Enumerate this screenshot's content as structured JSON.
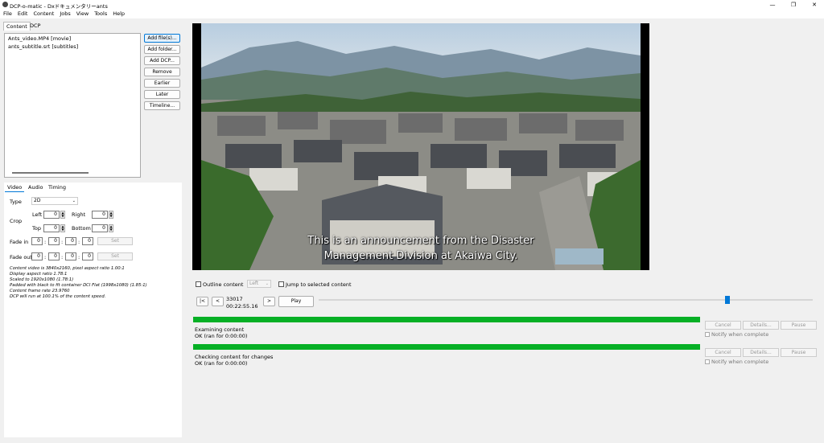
{
  "window": {
    "title": "DCP-o-matic - Dxドキュメンタリーants",
    "minimize": "—",
    "maximize": "❐",
    "close": "✕"
  },
  "menu": [
    "File",
    "Edit",
    "Content",
    "Jobs",
    "View",
    "Tools",
    "Help"
  ],
  "notebook_tabs": {
    "content": "Content",
    "dcp": "DCP"
  },
  "content_list": [
    "Ants_video.MP4 [movie]",
    "ants_subtitle.srt [subtitles]"
  ],
  "side_buttons": [
    "Add file(s)...",
    "Add folder...",
    "Add DCP...",
    "Remove",
    "Earlier",
    "Later",
    "Timeline..."
  ],
  "panel_tabs": {
    "video": "Video",
    "audio": "Audio",
    "timing": "Timing"
  },
  "video": {
    "type_label": "Type",
    "type_value": "2D",
    "crop_label": "Crop",
    "left_label": "Left",
    "left_value": "0",
    "right_label": "Right",
    "right_value": "0",
    "top_label": "Top",
    "top_value": "0",
    "bottom_label": "Bottom",
    "bottom_value": "0",
    "fade_in_label": "Fade in",
    "fade_out_label": "Fade out",
    "fade_in": [
      "0",
      "0",
      "0",
      "0"
    ],
    "fade_out": [
      "0",
      "0",
      "0",
      "0"
    ],
    "set_label": "Set",
    "info": [
      "Content video is 3840x2160, pixel aspect ratio 1.00:1",
      "Display aspect ratio 1.78:1",
      "Scaled to 1920x1080 (1.78:1)",
      "Padded with black to fit container DCI Flat (1998x1080) (1.85:1)",
      "Content frame rate 23.9760",
      "DCP will run at 100.1% of the content speed."
    ]
  },
  "viewer": {
    "subtitle_line1": "This is an announcement from the Disaster",
    "subtitle_line2": "Management Division at Akaiwa City."
  },
  "controls": {
    "outline_content": "Outline content",
    "eye": "Left",
    "jump_to_selected": "Jump to selected content",
    "go_start": "|<",
    "back": "<",
    "frame": "33017",
    "timecode": "00:22:55.16",
    "forward": ">",
    "play": "Play",
    "position_fraction": 0.82
  },
  "jobs": [
    {
      "title": "Examining content",
      "status": "OK (ran for 0:00:00)",
      "progress": 1.0
    },
    {
      "title": "Checking content for changes",
      "status": "OK (ran for 0:00:00)",
      "progress": 1.0
    }
  ],
  "job_buttons": {
    "cancel": "Cancel",
    "details": "Details...",
    "pause": "Pause",
    "notify": "Notify when complete"
  },
  "colors": {
    "progress": "#06b025",
    "accent": "#0078d7"
  }
}
